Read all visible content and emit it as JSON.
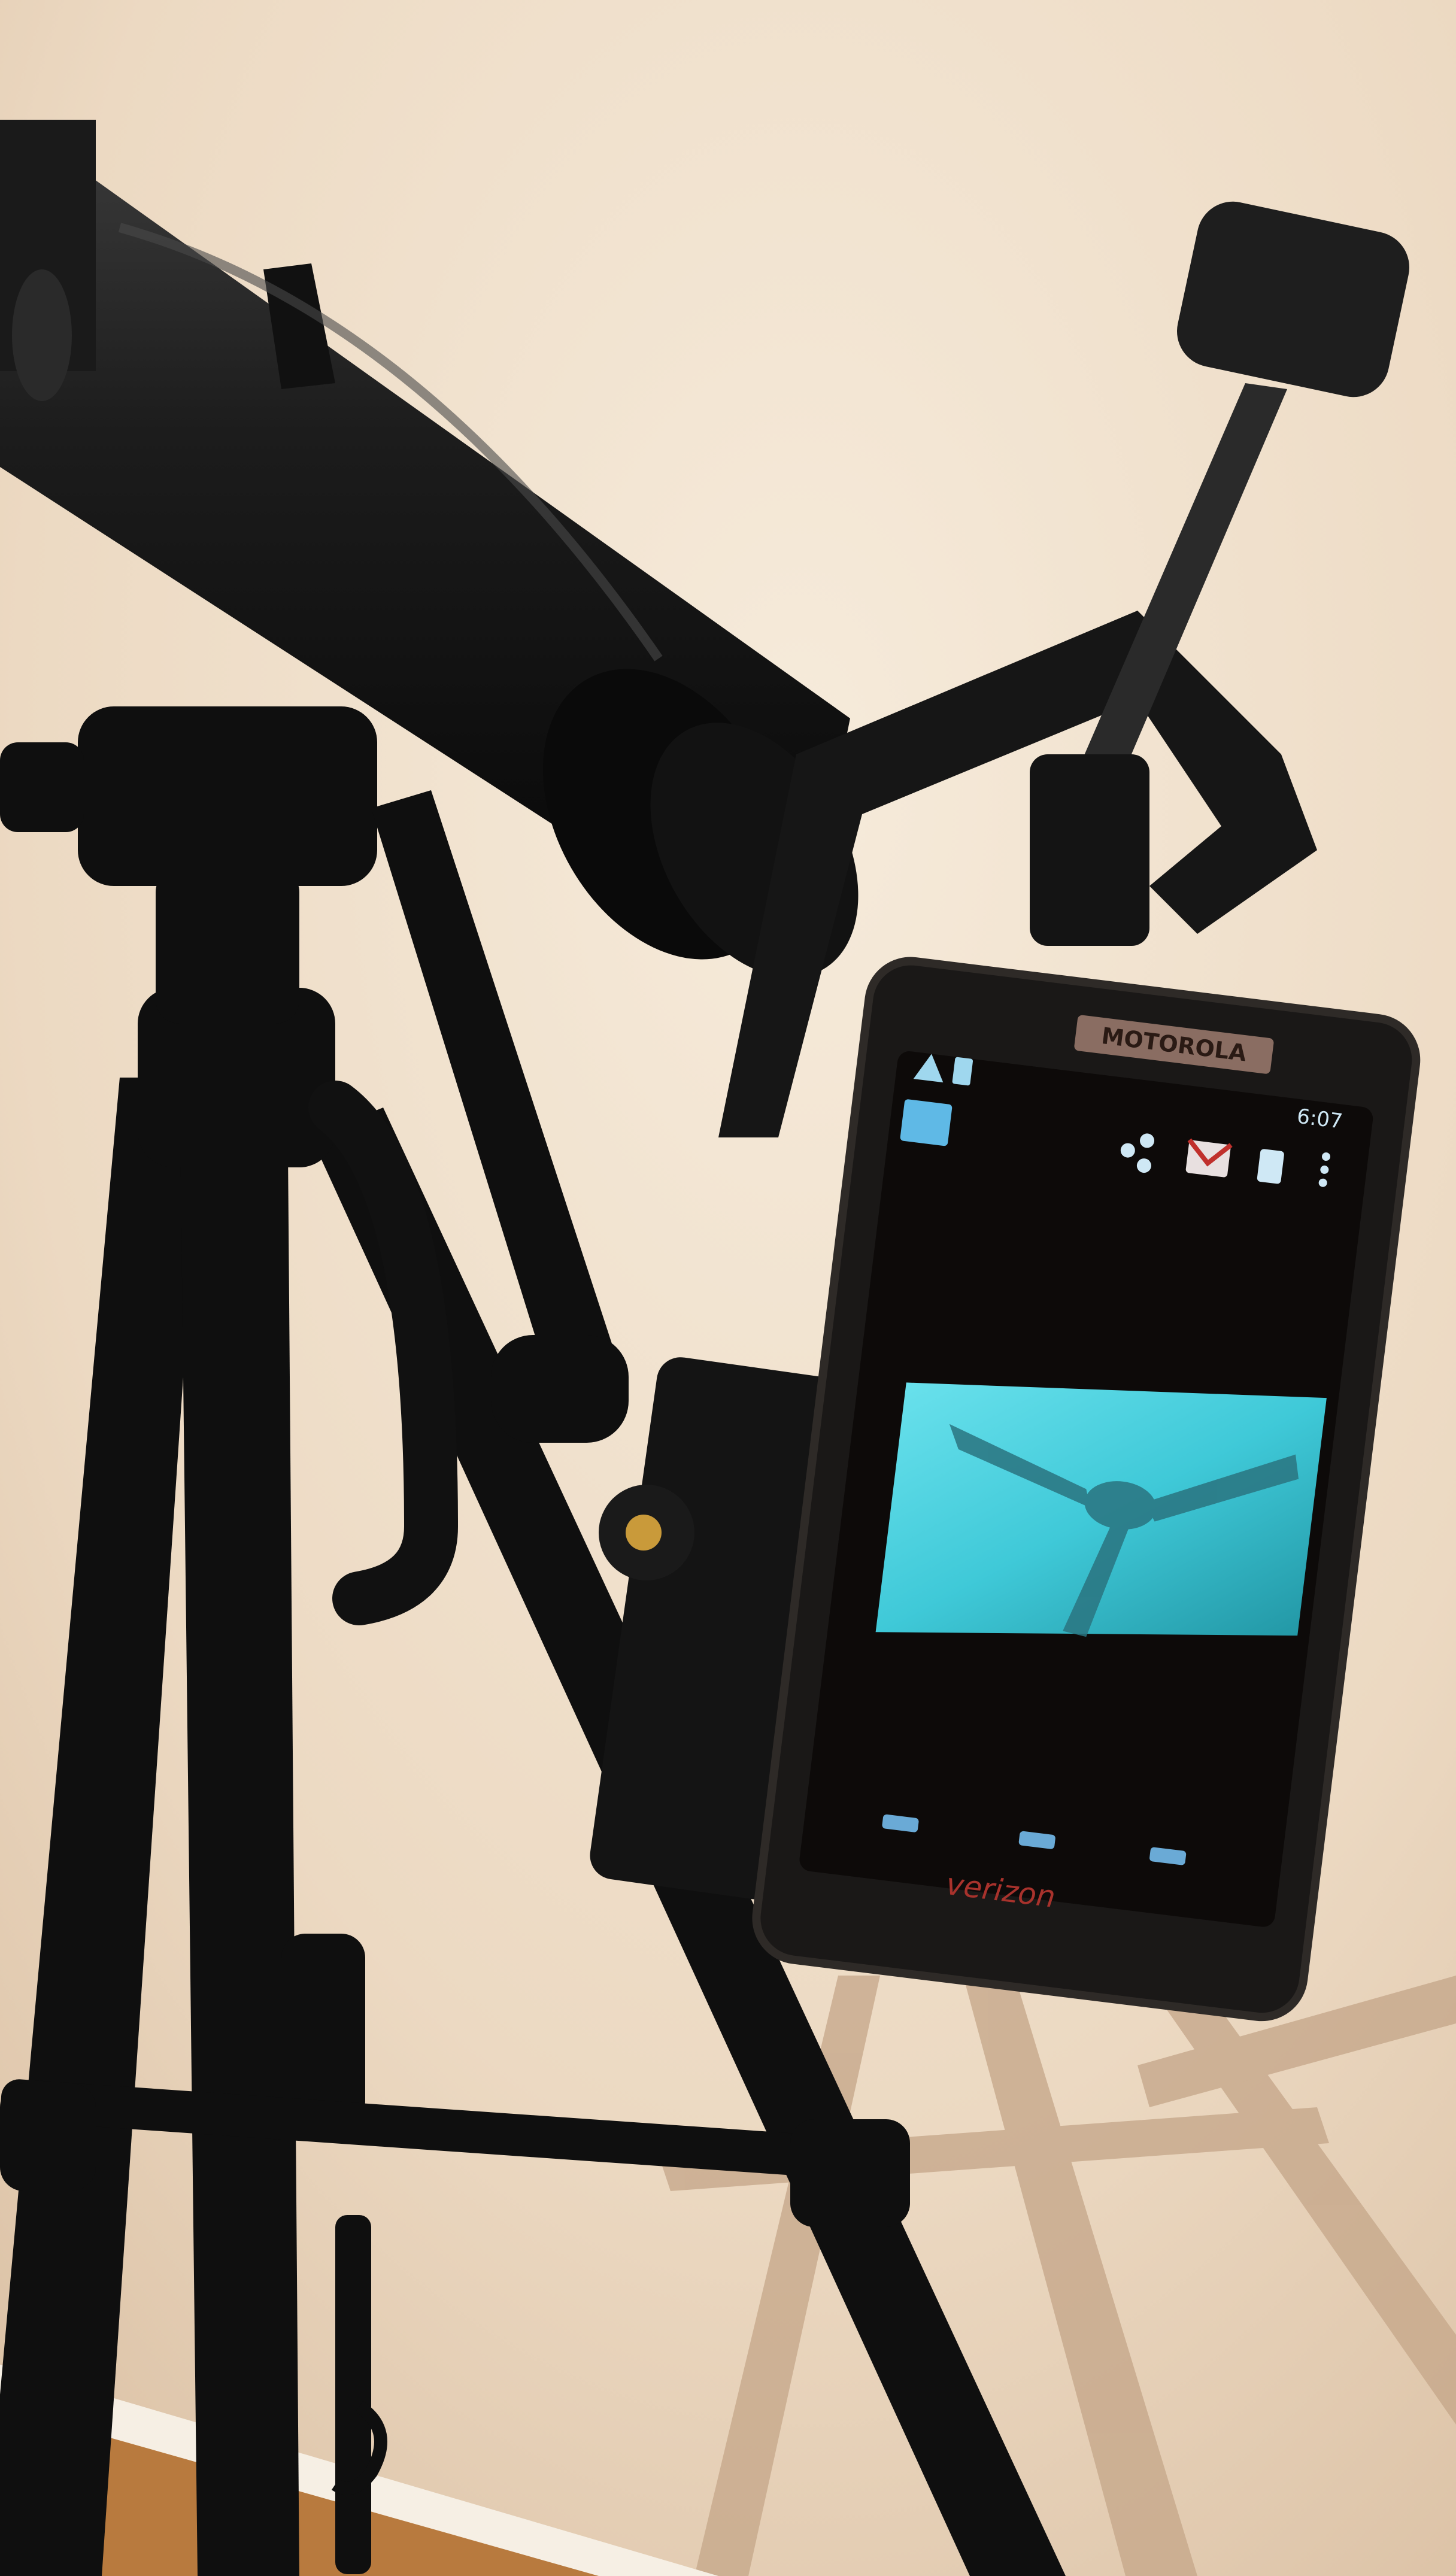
{
  "scene": {
    "description_free": true,
    "colors": {
      "wall_light": "#f3e6d3",
      "wall_mid": "#e6cfb5",
      "wall_dark": "#c9ad90",
      "floor": "#b87a3e",
      "baseboard": "#f6efe4",
      "telescope": "#141414",
      "tripod": "#0f0f0f",
      "phone_body": "#1a1817",
      "phone_screen": "#0d0a09",
      "viewfinder": "#3fc9d8",
      "brass": "#c99a3a"
    }
  },
  "phone": {
    "brand": "MOTOROLA",
    "carrier": "verizon",
    "status_time": "6:07",
    "icons": {
      "warning": "warning-icon",
      "sim": "sim-icon",
      "gallery": "gallery-icon",
      "share": "share-icon",
      "mail": "mail-icon",
      "trash": "trash-icon",
      "menu": "overflow-menu-icon",
      "back": "back-icon",
      "home": "home-icon",
      "recent": "recent-apps-icon"
    }
  }
}
